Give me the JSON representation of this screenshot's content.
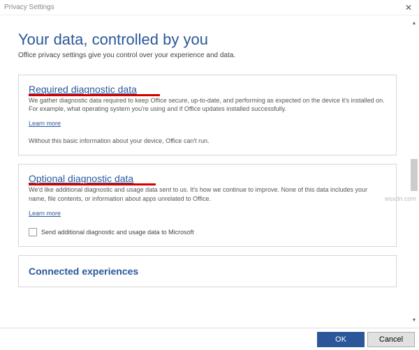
{
  "window": {
    "title": "Privacy Settings",
    "close": "✕"
  },
  "page": {
    "heading": "Your data, controlled by you",
    "subtitle": "Office privacy settings give you control over your experience and data."
  },
  "required": {
    "title": "Required diagnostic data",
    "desc": "We gather diagnostic data required to keep Office secure, up-to-date, and performing as expected on the device it's installed on. For example, what operating system you're using and if Office updates installed successfully.",
    "learn": "Learn more",
    "note": "Without this basic information about your device, Office can't run."
  },
  "optional": {
    "title": "Optional diagnostic data",
    "desc": "We'd like additional diagnostic and usage data sent to us. It's how we continue to improve. None of this data includes your name, file contents, or information about apps unrelated to Office.",
    "learn": "Learn more",
    "checkbox": "Send additional diagnostic and usage data to Microsoft"
  },
  "connected": {
    "title": "Connected experiences"
  },
  "footer": {
    "ok": "OK",
    "cancel": "Cancel"
  },
  "watermark": "wsxdn.com"
}
